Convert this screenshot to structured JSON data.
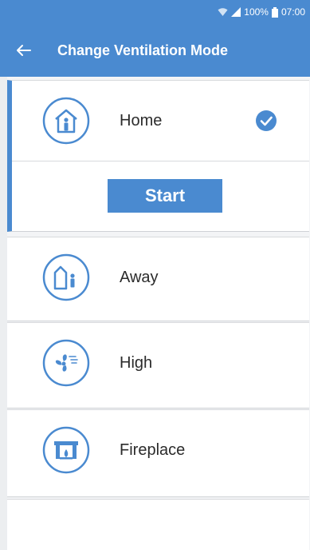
{
  "status_bar": {
    "battery": "100%",
    "time": "07:00",
    "wifi_icon": "wifi-icon",
    "signal_icon": "signal-icon",
    "battery_icon": "battery-icon"
  },
  "app_bar": {
    "back_icon": "back-arrow-icon",
    "title": "Change Ventilation Mode"
  },
  "modes": [
    {
      "label": "Home",
      "icon": "home-icon",
      "selected": true
    },
    {
      "label": "Away",
      "icon": "away-icon",
      "selected": false
    },
    {
      "label": "High",
      "icon": "fan-icon",
      "selected": false
    },
    {
      "label": "Fireplace",
      "icon": "fireplace-icon",
      "selected": false
    }
  ],
  "start_button": {
    "label": "Start"
  },
  "colors": {
    "accent": "#4a8ad0",
    "background": "#ffffff"
  }
}
